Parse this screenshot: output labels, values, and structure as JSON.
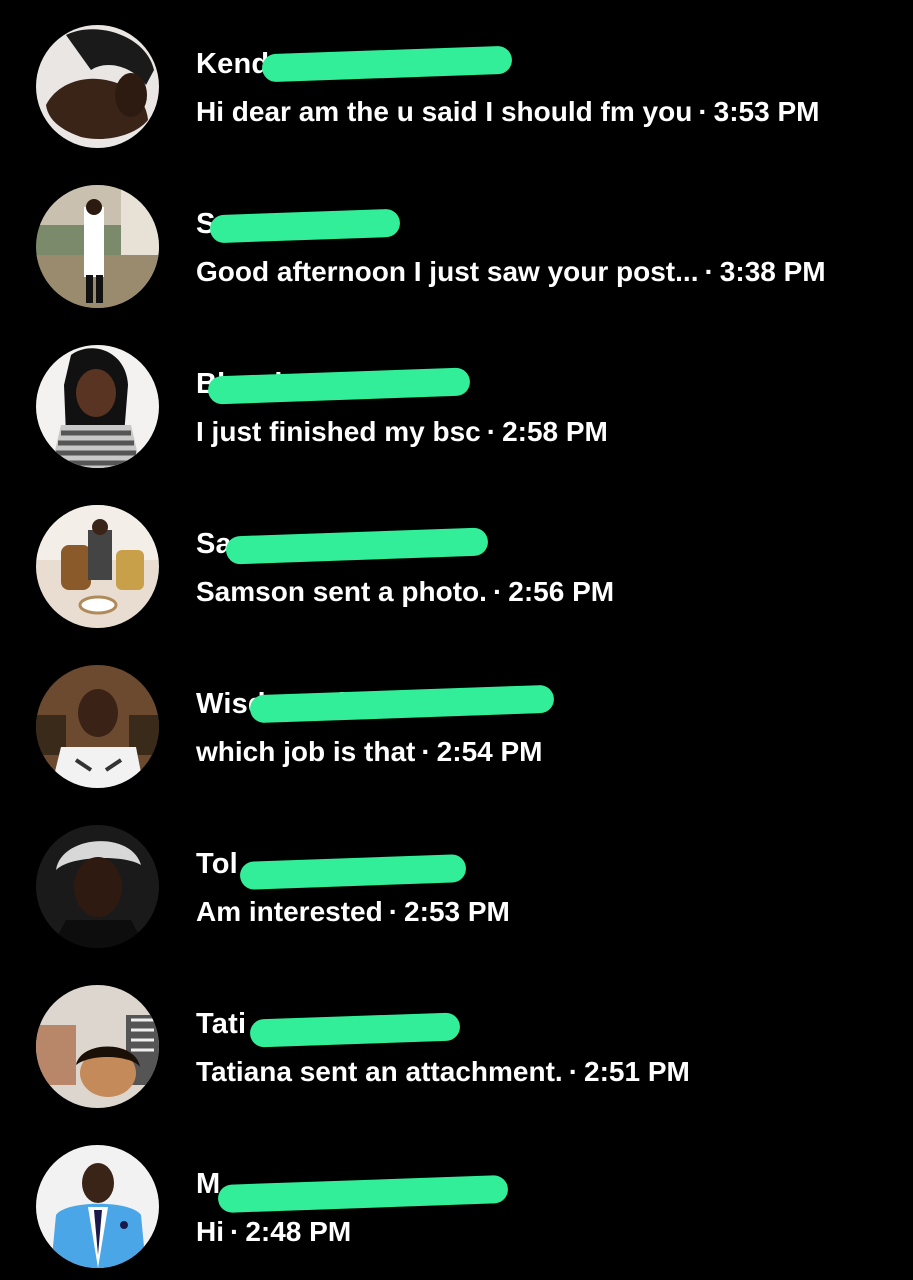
{
  "colors": {
    "background": "#000000",
    "text": "#ffffff",
    "redaction_marker": "#33ee99"
  },
  "separator": "·",
  "conversations": [
    {
      "name": "Kend",
      "message": "Hi dear am the u said I should fm you",
      "time": "3:53 PM",
      "avatar": "avatar-1"
    },
    {
      "name": "S",
      "message": "Good afternoon  I just saw your post...",
      "time": "3:38 PM",
      "avatar": "avatar-2"
    },
    {
      "name": "Blessing Moses",
      "message": "I just finished my bsc",
      "time": "2:58 PM",
      "avatar": "avatar-3"
    },
    {
      "name": "Sa",
      "message": "Samson sent a photo.",
      "time": "2:56 PM",
      "avatar": "avatar-4"
    },
    {
      "name": "Wisdom Abiodun Allen",
      "message": "which job is that",
      "time": "2:54 PM",
      "avatar": "avatar-5"
    },
    {
      "name": "Tol",
      "message": "Am interested",
      "time": "2:53 PM",
      "avatar": "avatar-6"
    },
    {
      "name": "Tati",
      "message": "Tatiana sent an attachment.",
      "time": "2:51 PM",
      "avatar": "avatar-7"
    },
    {
      "name": "M",
      "message": "Hi",
      "time": "2:48 PM",
      "avatar": "avatar-8"
    }
  ]
}
